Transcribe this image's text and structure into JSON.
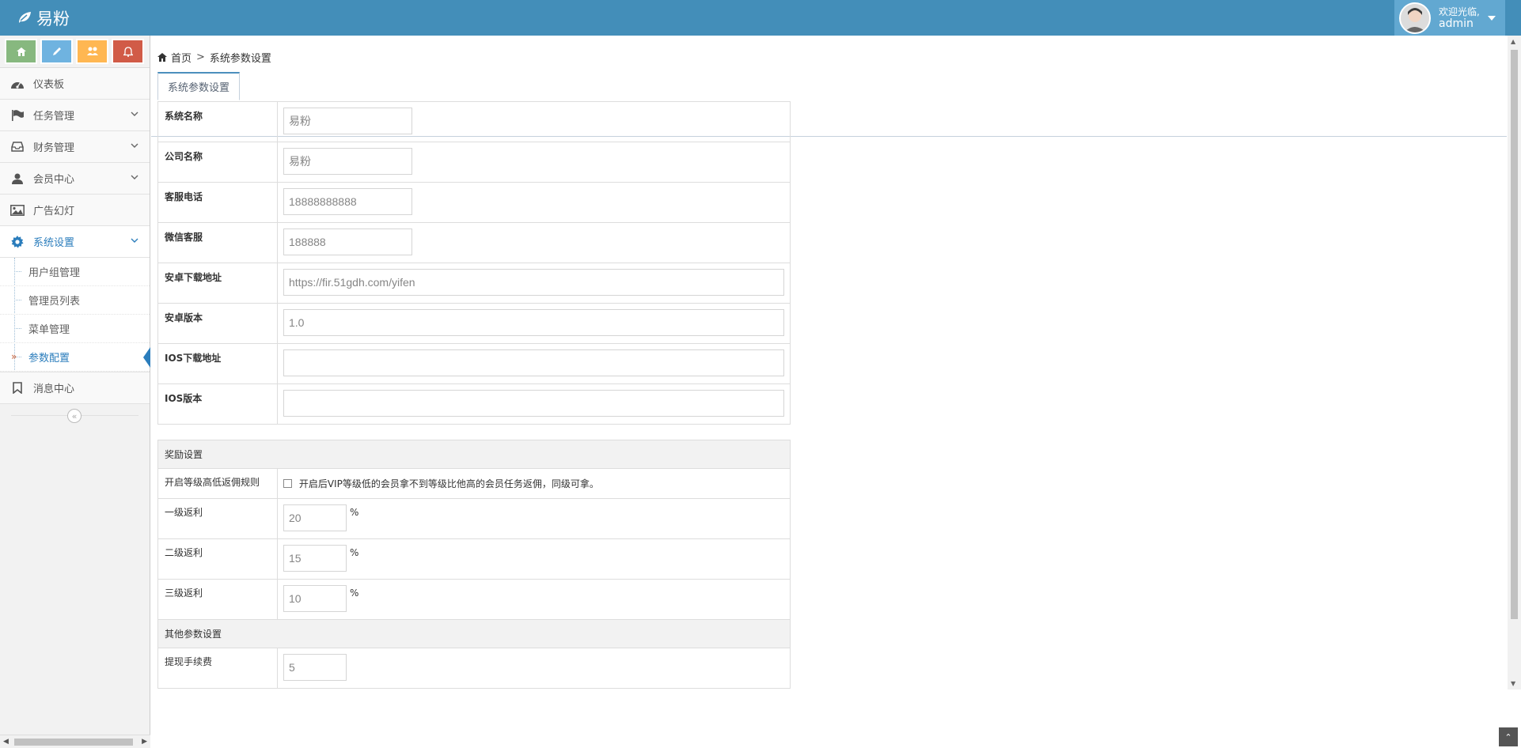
{
  "brand": {
    "name": "易粉",
    "icon": "leaf-icon"
  },
  "user": {
    "greeting": "欢迎光临,",
    "name": "admin"
  },
  "shortcuts": [
    {
      "icon": "home-icon",
      "color": "#87b87f"
    },
    {
      "icon": "pencil-icon",
      "color": "#6fb3e0"
    },
    {
      "icon": "users-icon",
      "color": "#ffb752"
    },
    {
      "icon": "bell-icon",
      "color": "#d15b47"
    }
  ],
  "sidebar": {
    "items": [
      {
        "label": "仪表板",
        "icon": "dashboard-icon"
      },
      {
        "label": "任务管理",
        "icon": "flag-icon"
      },
      {
        "label": "财务管理",
        "icon": "inbox-icon"
      },
      {
        "label": "会员中心",
        "icon": "user-icon"
      },
      {
        "label": "广告幻灯",
        "icon": "picture-icon"
      },
      {
        "label": "系统设置",
        "icon": "gear-icon"
      },
      {
        "label": "消息中心",
        "icon": "bookmark-icon"
      }
    ],
    "submenu": [
      {
        "label": "用户组管理"
      },
      {
        "label": "管理员列表"
      },
      {
        "label": "菜单管理"
      },
      {
        "label": "参数配置"
      }
    ]
  },
  "breadcrumb": {
    "home": "首页",
    "current": "系统参数设置"
  },
  "tab": {
    "label": "系统参数设置"
  },
  "basic": {
    "site_name_label": "系统名称",
    "site_name_value": "易粉",
    "company_label": "公司名称",
    "company_value": "易粉",
    "phone_label": "客服电话",
    "phone_value": "18888888888",
    "wechat_label": "微信客服",
    "wechat_value": "188888",
    "android_url_label": "安卓下载地址",
    "android_url_value": "https://fir.51gdh.com/yifen",
    "android_ver_label": "安卓版本",
    "android_ver_value": "1.0",
    "ios_url_label": "IOS下载地址",
    "ios_url_value": "",
    "ios_ver_label": "IOS版本",
    "ios_ver_value": ""
  },
  "reward": {
    "header": "奖励设置",
    "rule_label": "开启等级高低返佣规则",
    "rule_text": "开启后VIP等级低的会员拿不到等级比他高的会员任务返佣，同级可拿。",
    "level1_label": "一级返利",
    "level1_value": "20",
    "level2_label": "二级返利",
    "level2_value": "15",
    "level3_label": "三级返利",
    "level3_value": "10",
    "unit": "%"
  },
  "other": {
    "header": "其他参数设置",
    "fee_label": "提现手续费",
    "fee_value": "5"
  }
}
